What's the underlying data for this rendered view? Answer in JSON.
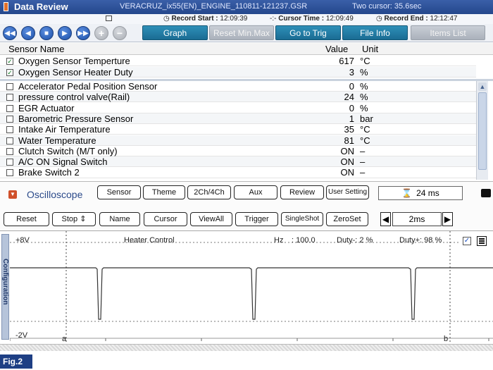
{
  "title_bar": {
    "title": "Data Review",
    "file_name": "VERACRUZ_ix55(EN)_ENGINE_110811-121237.GSR",
    "cursor_info": "Two cursor: 35.6sec"
  },
  "record": {
    "start_label": "Record Start :",
    "start_value": "12:09:39",
    "cursor_label": "Cursor Time :",
    "cursor_value": "12:09:49",
    "end_label": "Record End :",
    "end_value": "12:12:47"
  },
  "toolbar": {
    "nav_icons": [
      "rewind-icon",
      "previous-icon",
      "stop-icon",
      "next-icon",
      "fast-forward-icon",
      "plus-icon",
      "minus-icon"
    ],
    "buttons": {
      "graph": "Graph",
      "reset_minmax": "Reset Min.Max",
      "go_to_trig": "Go to Trig",
      "file_info": "File Info",
      "items_list": "Items List"
    }
  },
  "table": {
    "headers": {
      "name": "Sensor Name",
      "value": "Value",
      "unit": "Unit"
    },
    "pinned_rows": [
      {
        "name": "Oxygen Sensor Temperture",
        "value": "617",
        "unit": "°C",
        "checked": true
      },
      {
        "name": "Oxygen Sensor Heater Duty",
        "value": "3",
        "unit": "%",
        "checked": true
      }
    ],
    "rows": [
      {
        "name": "Accelerator Pedal Position Sensor",
        "value": "0",
        "unit": "%"
      },
      {
        "name": "pressure control valve(Rail)",
        "value": "24",
        "unit": "%"
      },
      {
        "name": "EGR Actuator",
        "value": "0",
        "unit": "%"
      },
      {
        "name": "Barometric Pressure Sensor",
        "value": "1",
        "unit": "bar"
      },
      {
        "name": "Intake Air Temperature",
        "value": "35",
        "unit": "°C"
      },
      {
        "name": "Water Temperature",
        "value": "81",
        "unit": "°C"
      },
      {
        "name": "Clutch Switch (M/T only)",
        "value": "ON",
        "unit": "–"
      },
      {
        "name": "A/C ON Signal Switch",
        "value": "ON",
        "unit": "–"
      },
      {
        "name": "Brake Switch 2",
        "value": "ON",
        "unit": "–"
      }
    ]
  },
  "oscilloscope": {
    "title": "Oscilloscope",
    "row1_buttons": [
      "Sensor",
      "Theme",
      "2Ch/4Ch",
      "Aux",
      "Review",
      "User Setting"
    ],
    "time_value": "24 ms",
    "row2_buttons": {
      "reset": "Reset",
      "stop": "Stop",
      "name": "Name",
      "cursor": "Cursor",
      "view_all": "ViewAll",
      "trigger": "Trigger",
      "single_shot": "SingleShot",
      "zero_set": "ZeroSet"
    },
    "time_div": "2ms"
  },
  "scope": {
    "config_tab": "Configuration",
    "top_voltage": "+8V",
    "bottom_voltage": "-2V",
    "channel_name": "Heater Control",
    "hz_label": "Hz",
    "hz_value": ": 100.0",
    "duty_minus": "Duty-: 2 %",
    "duty_plus": "Duty+: 98 %",
    "cursor_a": "a",
    "cursor_b": "b"
  },
  "figure_label": "Fig.2"
}
